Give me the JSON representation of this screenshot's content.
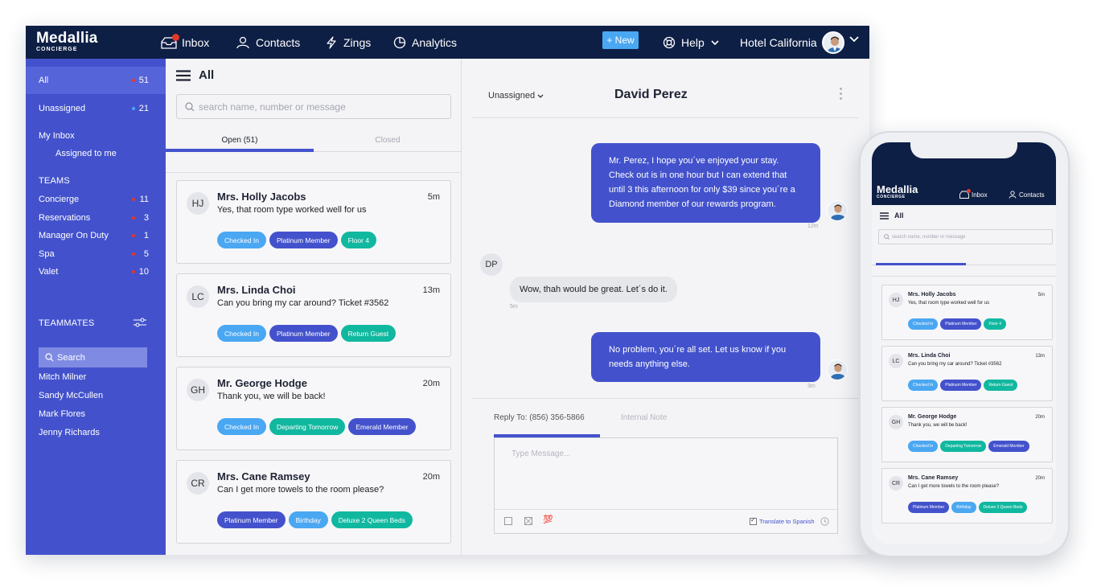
{
  "colors": {
    "navy": "#0e1f45",
    "brand_blue": "#4352cc",
    "light_blue": "#4aa7f2",
    "teal": "#11b8a0",
    "alert_red": "#e0392b"
  },
  "topbar": {
    "logo_main": "Medallia",
    "logo_sub": "CONCIERGE",
    "nav": {
      "inbox": "Inbox",
      "contacts": "Contacts",
      "zings": "Zings",
      "analytics": "Analytics"
    },
    "new_button": "+ New",
    "help": "Help",
    "hotel": "Hotel California"
  },
  "sidebar": {
    "all": {
      "label": "All",
      "count": "51"
    },
    "unassigned": {
      "label": "Unassigned",
      "count": "21"
    },
    "my_inbox": "My Inbox",
    "assigned_to_me": "Assigned to me",
    "teams_heading": "TEAMS",
    "teams": [
      {
        "label": "Concierge",
        "count": "11"
      },
      {
        "label": "Reservations",
        "count": "3"
      },
      {
        "label": "Manager On Duty",
        "count": "1"
      },
      {
        "label": "Spa",
        "count": "5"
      },
      {
        "label": "Valet",
        "count": "10"
      }
    ],
    "teammates_heading": "TEAMMATES",
    "search_label": "Search",
    "teammates": [
      "Mitch Milner",
      "Sandy McCullen",
      "Mark Flores",
      "Jenny Richards"
    ]
  },
  "list": {
    "title": "All",
    "search_placeholder": "search name, number or message",
    "tabs": {
      "open": "Open (51)",
      "closed": "Closed"
    },
    "conversations": [
      {
        "initials": "HJ",
        "name": "Mrs. Holly Jacobs",
        "time": "5m",
        "message": "Yes, that room type worked well for us",
        "tags": [
          {
            "label": "Checked In",
            "color": "#4aa7f2"
          },
          {
            "label": "Platinum Member",
            "color": "#4352cc"
          },
          {
            "label": "Floor 4",
            "color": "#11b8a0"
          }
        ]
      },
      {
        "initials": "LC",
        "name": "Mrs. Linda Choi",
        "time": "13m",
        "message": "Can you bring my car around? Ticket #3562",
        "tags": [
          {
            "label": "Checked In",
            "color": "#4aa7f2"
          },
          {
            "label": "Platinum Member",
            "color": "#4352cc"
          },
          {
            "label": "Return Guest",
            "color": "#11b8a0"
          }
        ]
      },
      {
        "initials": "GH",
        "name": "Mr. George Hodge",
        "time": "20m",
        "message": "Thank you, we will be back!",
        "tags": [
          {
            "label": "Checked In",
            "color": "#4aa7f2"
          },
          {
            "label": "Departing Tomorrow",
            "color": "#11b8a0"
          },
          {
            "label": "Emerald Member",
            "color": "#4352cc"
          }
        ]
      },
      {
        "initials": "CR",
        "name": "Mrs. Cane Ramsey",
        "time": "20m",
        "message": "Can I get more towels to the room please?",
        "tags": [
          {
            "label": "Platinum Member",
            "color": "#4352cc"
          },
          {
            "label": "Birthday",
            "color": "#4aa7f2"
          },
          {
            "label": "Deluxe 2 Queen Beds",
            "color": "#11b8a0"
          }
        ]
      }
    ]
  },
  "conversation": {
    "assignment": "Unassigned",
    "contact_name": "David Perez",
    "messages": [
      {
        "direction": "out",
        "text": "Mr. Perez, I hope you´ve enjoyed your stay. Check out is  in one hour but I can extend that until 3 this afternoon for only $39 since you´re a Diamond member of our rewards program.",
        "time": "12m"
      },
      {
        "direction": "in",
        "initials": "DP",
        "text": "Wow, thah would be great. Let´s do it.",
        "time": "5m"
      },
      {
        "direction": "out",
        "text": "No problem, you´re all set. Let us know if you needs anything else.",
        "time": "3m"
      }
    ],
    "compose": {
      "reply_to": "Reply To: (856) 356-5866",
      "internal_note": "Internal Note",
      "placeholder": "Type Message...",
      "translate_label": "Translate to Spanish",
      "emoji": "💯"
    }
  },
  "phone": {
    "logo_main": "Medallia",
    "logo_sub": "CONCIERGE",
    "nav_inbox": "Inbox",
    "nav_contacts": "Contacts",
    "title": "All",
    "search_placeholder": "search name, number or message"
  }
}
